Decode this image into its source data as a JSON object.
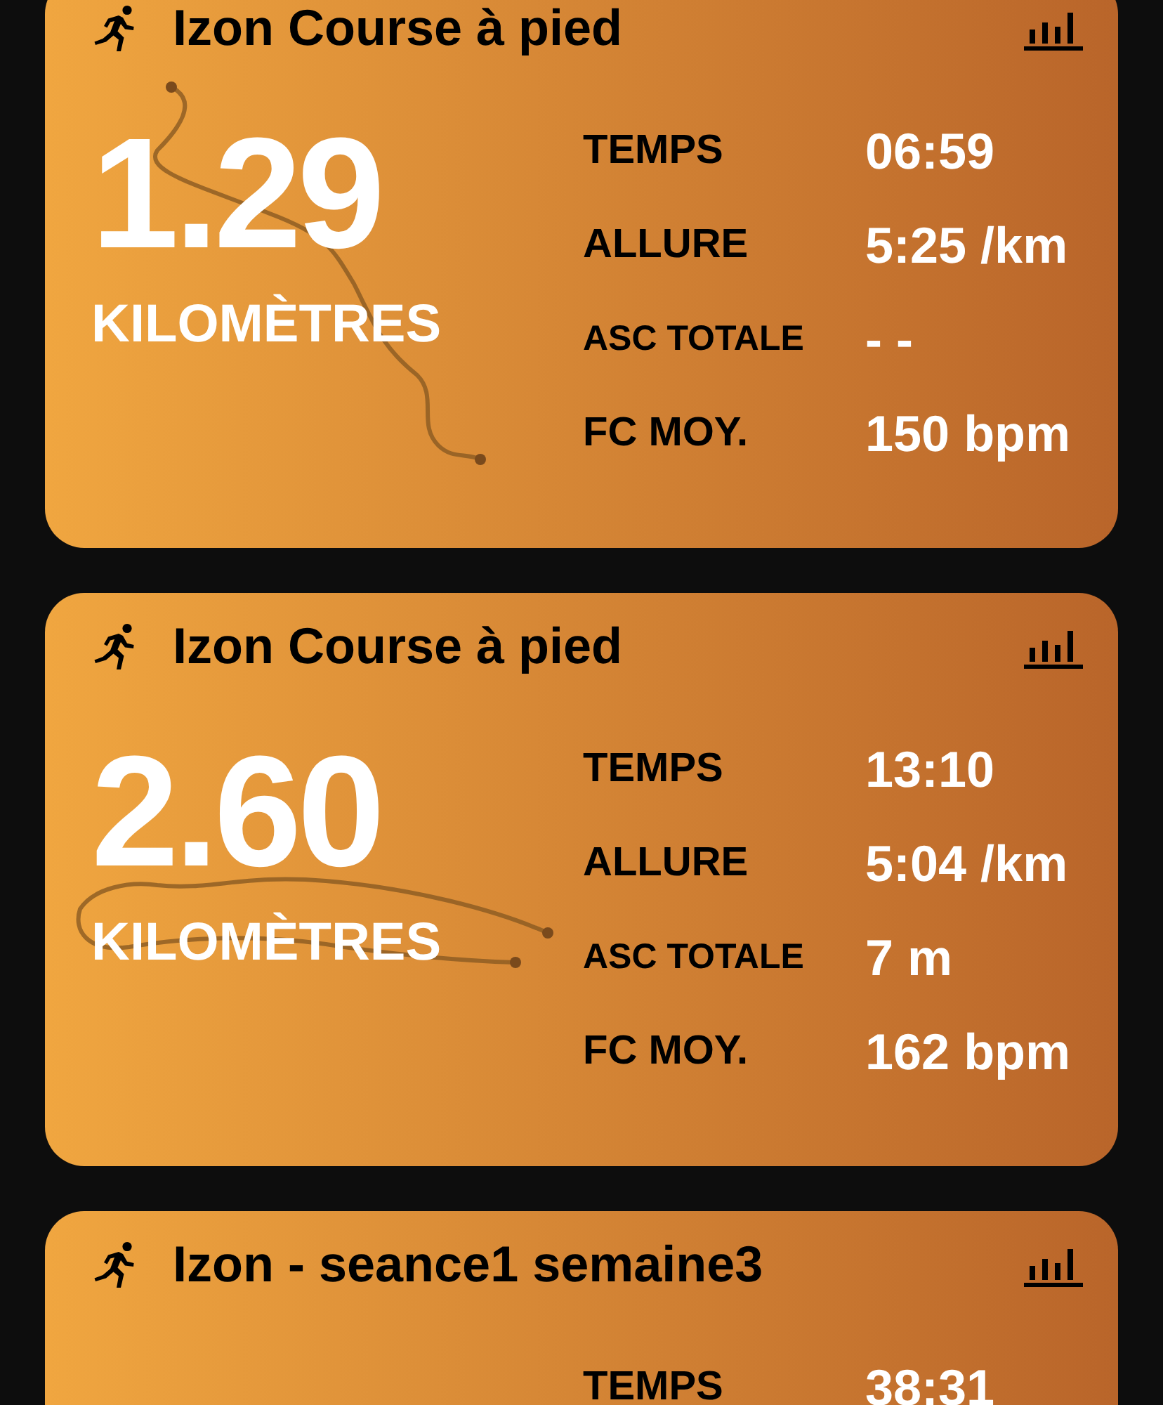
{
  "workouts": [
    {
      "title": "Izon Course à pied",
      "distance": "1.29",
      "unit": "KILOMÈTRES",
      "stats": [
        {
          "label": "TEMPS",
          "value": "06:59"
        },
        {
          "label": "ALLURE",
          "value": "5:25 /km"
        },
        {
          "label": "ASC TOTALE",
          "value": "- -"
        },
        {
          "label": "FC MOY.",
          "value": "150 bpm"
        }
      ]
    },
    {
      "title": "Izon Course à pied",
      "distance": "2.60",
      "unit": "KILOMÈTRES",
      "stats": [
        {
          "label": "TEMPS",
          "value": "13:10"
        },
        {
          "label": "ALLURE",
          "value": "5:04 /km"
        },
        {
          "label": "ASC TOTALE",
          "value": "7 m"
        },
        {
          "label": "FC MOY.",
          "value": "162 bpm"
        }
      ]
    },
    {
      "title": "Izon - seance1 semaine3",
      "stats": [
        {
          "label": "TEMPS",
          "value": "38:31"
        }
      ]
    }
  ]
}
